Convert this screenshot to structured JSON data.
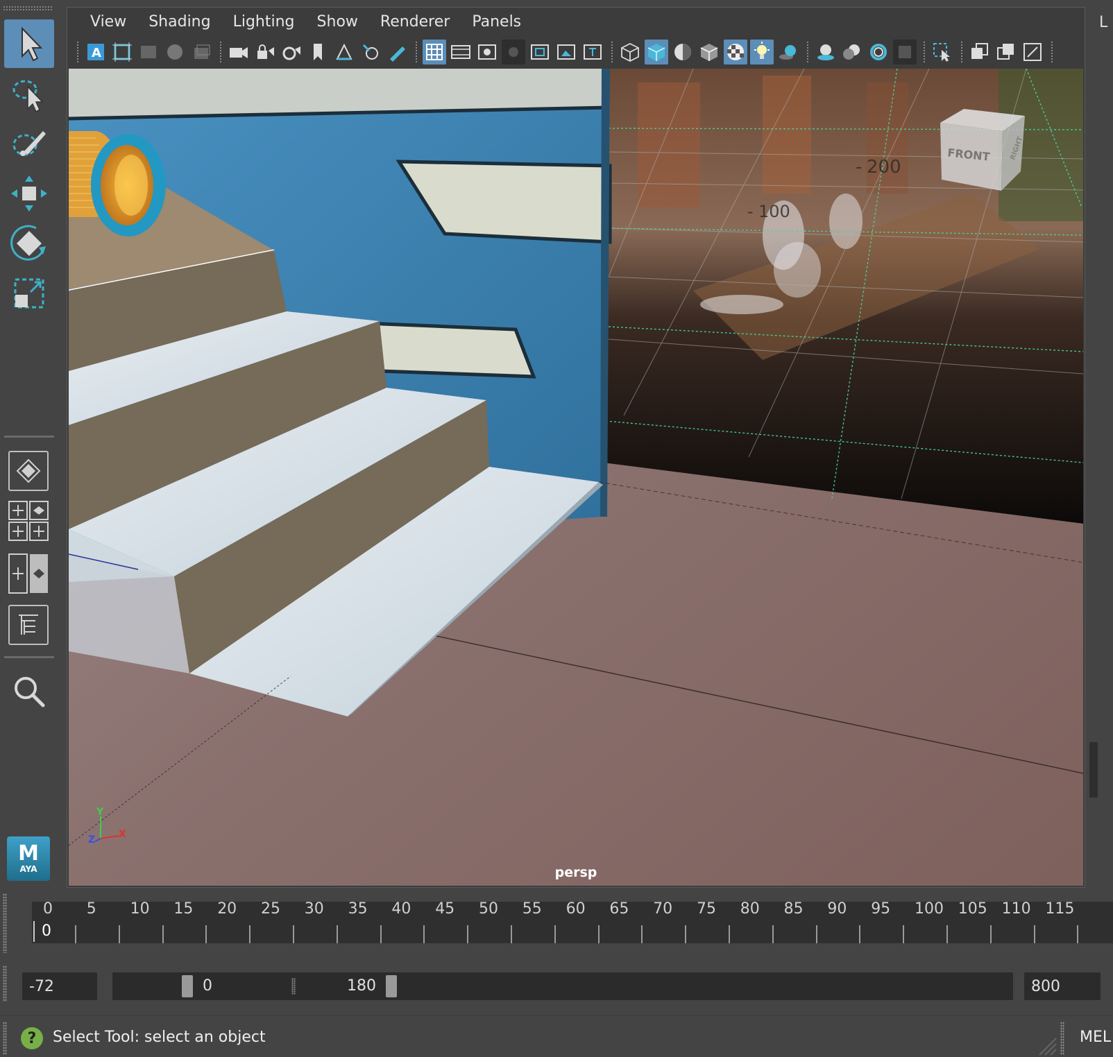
{
  "menu": {
    "items": [
      "View",
      "Shading",
      "Lighting",
      "Show",
      "Renderer",
      "Panels"
    ]
  },
  "toolbox": {
    "tools": [
      {
        "name": "select-tool",
        "icon": "arrow-cursor-icon",
        "active": true
      },
      {
        "name": "lasso-tool",
        "icon": "lasso-icon",
        "active": false
      },
      {
        "name": "paint-select-tool",
        "icon": "paint-select-icon",
        "active": false
      },
      {
        "name": "move-tool",
        "icon": "move-icon",
        "active": false
      },
      {
        "name": "rotate-tool",
        "icon": "rotate-icon",
        "active": false
      },
      {
        "name": "scale-tool",
        "icon": "scale-icon",
        "active": false
      }
    ],
    "logo": {
      "letter": "M",
      "text": "AYA"
    }
  },
  "viewport": {
    "camera": "persp",
    "grid_labels": [
      "200",
      "100"
    ],
    "view_cube_label": "FRONT",
    "view_cube_side": "RIGHT",
    "axis": {
      "y": "Y",
      "z": "Z",
      "x": "X"
    }
  },
  "right_strip": {
    "letter": "L"
  },
  "timeline": {
    "ticks": [
      "0",
      "5",
      "10",
      "15",
      "20",
      "25",
      "30",
      "35",
      "40",
      "45",
      "50",
      "55",
      "60",
      "65",
      "70",
      "75",
      "80",
      "85",
      "90",
      "95",
      "100",
      "105",
      "110",
      "115"
    ],
    "current_frame": "0"
  },
  "range": {
    "anim_start": "-72",
    "range_start": "0",
    "range_end": "180",
    "anim_end": "800"
  },
  "status": {
    "help_glyph": "?",
    "text": "Select Tool: select an object",
    "script_type": "MEL"
  },
  "colors": {
    "accent": "#5c8eb8",
    "viewport_floor": "#876a68",
    "wall_blue": "#3a7fae",
    "step_top": "#d9e2e8",
    "step_riser": "#756958",
    "grid_green": "#49d4a0",
    "help_green": "#78b048"
  }
}
